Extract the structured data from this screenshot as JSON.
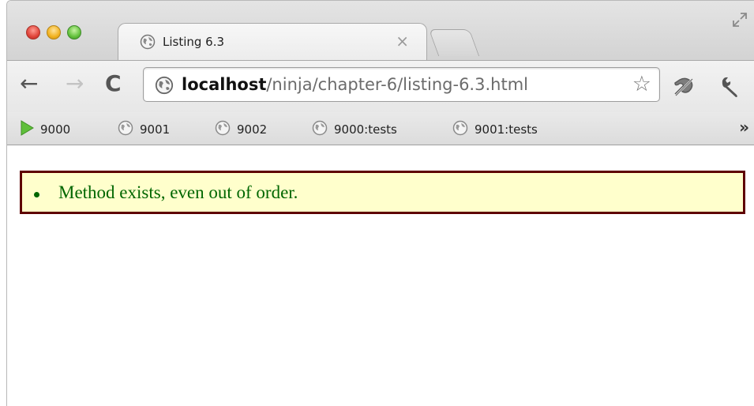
{
  "tab": {
    "title": "Listing 6.3",
    "close_glyph": "×"
  },
  "toolbar": {
    "back_glyph": "←",
    "forward_glyph": "→",
    "reload_glyph": "C",
    "url_host": "localhost",
    "url_path": "/ninja/chapter-6/listing-6.3.html",
    "bookmark_star_glyph": "☆"
  },
  "bookmarks_bar": {
    "items": [
      {
        "label": "9000",
        "icon": "play-icon"
      },
      {
        "label": "9001",
        "icon": "globe-icon"
      },
      {
        "label": "9002",
        "icon": "globe-icon"
      },
      {
        "label": "9000:tests",
        "icon": "globe-icon"
      },
      {
        "label": "9001:tests",
        "icon": "globe-icon"
      }
    ],
    "overflow_glyph": "»"
  },
  "page": {
    "results": [
      {
        "text": "Method exists, even out of order.",
        "status": "pass"
      }
    ]
  },
  "colors": {
    "result_text": "#006600",
    "result_background": "#ffffcc",
    "result_border": "#5e0000"
  }
}
